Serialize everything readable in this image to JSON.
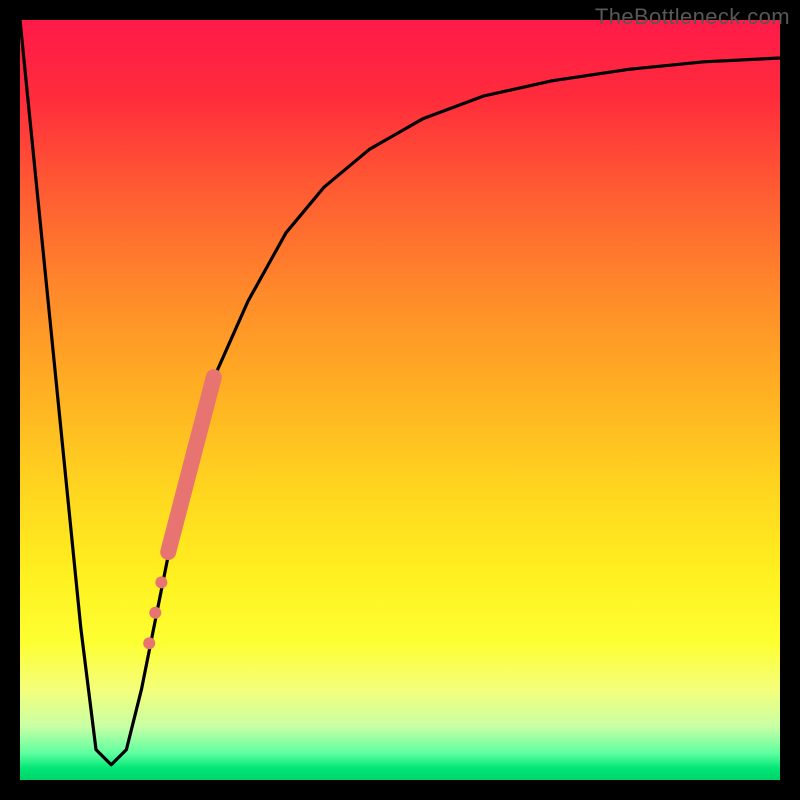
{
  "watermark": "TheBottleneck.com",
  "colors": {
    "background": "#000000",
    "curve": "#000000",
    "marker": "#e77471"
  },
  "chart_data": {
    "type": "line",
    "title": "",
    "xlabel": "",
    "ylabel": "",
    "xlim": [
      0,
      100
    ],
    "ylim": [
      0,
      100
    ],
    "grid": false,
    "series": [
      {
        "name": "bottleneck-curve",
        "x": [
          0,
          4,
          8,
          10,
          12,
          14,
          16,
          18,
          20,
          23,
          26,
          30,
          35,
          40,
          46,
          53,
          61,
          70,
          80,
          90,
          100
        ],
        "values": [
          100,
          60,
          20,
          4,
          2,
          4,
          12,
          22,
          32,
          44,
          54,
          63,
          72,
          78,
          83,
          87,
          90,
          92,
          93.5,
          94.5,
          95
        ]
      }
    ],
    "markers": {
      "name": "highlight-segment",
      "points": [
        {
          "x": 17.0,
          "y": 18,
          "r": 6
        },
        {
          "x": 17.8,
          "y": 22,
          "r": 6
        },
        {
          "x": 18.6,
          "y": 26,
          "r": 6
        }
      ],
      "thick_segment": {
        "x0": 19.5,
        "y0": 30,
        "x1": 25.5,
        "y1": 53
      }
    }
  }
}
